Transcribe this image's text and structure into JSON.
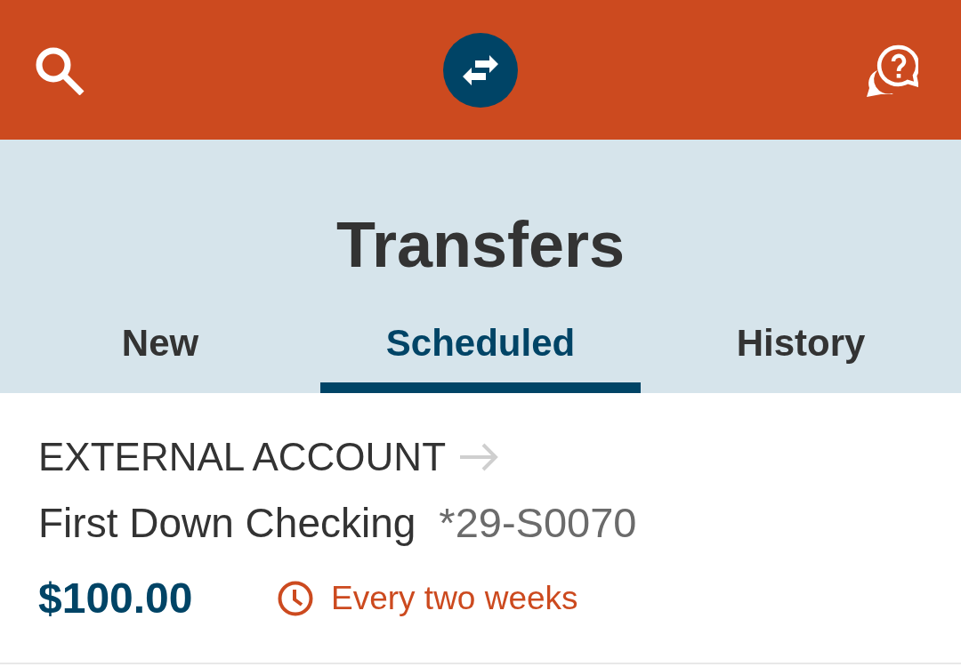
{
  "header": {
    "title": "Transfers"
  },
  "tabs": [
    {
      "label": "New",
      "selected": false
    },
    {
      "label": "Scheduled",
      "selected": true
    },
    {
      "label": "History",
      "selected": false
    }
  ],
  "transfers": [
    {
      "from": "EXTERNAL ACCOUNT",
      "account_name": "First Down Checking",
      "account_number": "*29-S0070",
      "amount": "$100.00",
      "frequency": "Every two weeks"
    }
  ]
}
